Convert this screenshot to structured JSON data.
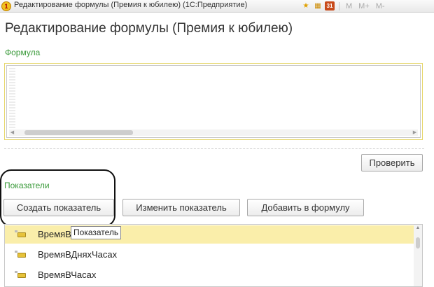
{
  "window": {
    "title": "Редактирование формулы (Премия к юбилею)  (1С:Предприятие)",
    "icons": [
      "app-icon",
      "star-icon",
      "table-icon",
      "calendar-icon",
      "memory-icon"
    ],
    "calendar_number": "31",
    "memory_labels": [
      "M",
      "M+",
      "M-"
    ]
  },
  "form": {
    "title": "Редактирование формулы (Премия к юбилею)"
  },
  "formula": {
    "label": "Формула",
    "value": ""
  },
  "check_button": "Проверить",
  "indicators": {
    "label": "Показатели",
    "buttons": {
      "create": "Создать показатель",
      "edit": "Изменить показатель",
      "add": "Добавить в формулу"
    },
    "items": [
      "ВремяВ",
      "ВремяВДняхЧасах",
      "ВремяВЧасах"
    ],
    "tooltip": "Показатель"
  },
  "colors": {
    "section_label": "#3a9a3a",
    "selected_row": "#faeeaa",
    "annotation_circle": "#111111"
  }
}
